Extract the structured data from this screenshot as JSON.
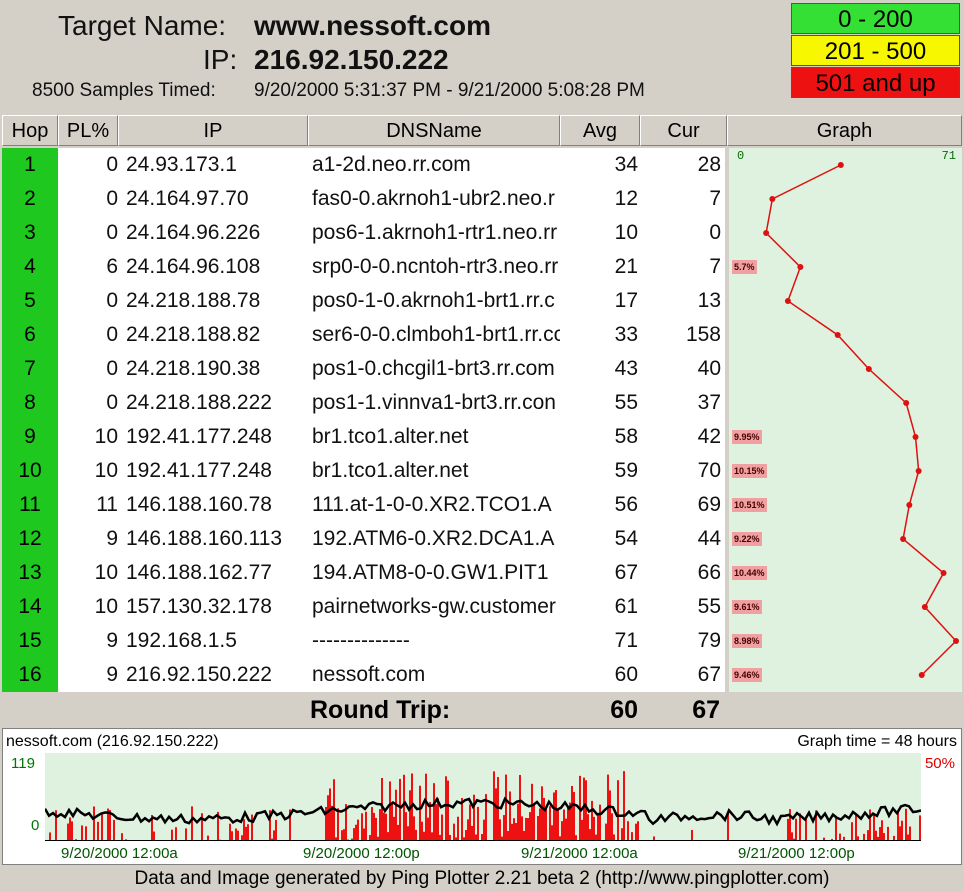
{
  "header": {
    "target_label": "Target Name:",
    "target_value": "www.nessoft.com",
    "ip_label": "IP:",
    "ip_value": "216.92.150.222",
    "samples_label": "8500 Samples Timed:",
    "samples_value": "9/20/2000 5:31:37 PM - 9/21/2000 5:08:28 PM"
  },
  "legend": [
    {
      "label": "0 - 200",
      "color": "#33e033"
    },
    {
      "label": "201 - 500",
      "color": "#f7f700"
    },
    {
      "label": "501 and up",
      "color": "#ee1111"
    }
  ],
  "columns": [
    "Hop",
    "PL%",
    "IP",
    "DNSName",
    "Avg",
    "Cur",
    "Graph"
  ],
  "graph_scale": {
    "min": "0",
    "max": "71",
    "max_value": 71
  },
  "hops": [
    {
      "hop": "1",
      "pl": "0",
      "ip": "24.93.173.1",
      "dns": "a1-2d.neo.rr.com",
      "avg": "34",
      "cur": "28",
      "pl_label": "",
      "avg_value": 34
    },
    {
      "hop": "2",
      "pl": "0",
      "ip": "24.164.97.70",
      "dns": "fas0-0.akrnoh1-ubr2.neo.r",
      "avg": "12",
      "cur": "7",
      "pl_label": "",
      "avg_value": 12
    },
    {
      "hop": "3",
      "pl": "0",
      "ip": "24.164.96.226",
      "dns": "pos6-1.akrnoh1-rtr1.neo.rr",
      "avg": "10",
      "cur": "0",
      "pl_label": "",
      "avg_value": 10
    },
    {
      "hop": "4",
      "pl": "6",
      "ip": "24.164.96.108",
      "dns": "srp0-0-0.ncntoh-rtr3.neo.rr",
      "avg": "21",
      "cur": "7",
      "pl_label": "5.7%",
      "avg_value": 21
    },
    {
      "hop": "5",
      "pl": "0",
      "ip": "24.218.188.78",
      "dns": "pos0-1-0.akrnoh1-brt1.rr.c",
      "avg": "17",
      "cur": "13",
      "pl_label": "",
      "avg_value": 17
    },
    {
      "hop": "6",
      "pl": "0",
      "ip": "24.218.188.82",
      "dns": "ser6-0-0.clmboh1-brt1.rr.cc",
      "avg": "33",
      "cur": "158",
      "pl_label": "",
      "avg_value": 33
    },
    {
      "hop": "7",
      "pl": "0",
      "ip": "24.218.190.38",
      "dns": "pos1-0.chcgil1-brt3.rr.com",
      "avg": "43",
      "cur": "40",
      "pl_label": "",
      "avg_value": 43
    },
    {
      "hop": "8",
      "pl": "0",
      "ip": "24.218.188.222",
      "dns": "pos1-1.vinnva1-brt3.rr.con",
      "avg": "55",
      "cur": "37",
      "pl_label": "",
      "avg_value": 55
    },
    {
      "hop": "9",
      "pl": "10",
      "ip": "192.41.177.248",
      "dns": "br1.tco1.alter.net",
      "avg": "58",
      "cur": "42",
      "pl_label": "9.95%",
      "avg_value": 58
    },
    {
      "hop": "10",
      "pl": "10",
      "ip": "192.41.177.248",
      "dns": "br1.tco1.alter.net",
      "avg": "59",
      "cur": "70",
      "pl_label": "10.15%",
      "avg_value": 59
    },
    {
      "hop": "11",
      "pl": "11",
      "ip": "146.188.160.78",
      "dns": "111.at-1-0-0.XR2.TCO1.A",
      "avg": "56",
      "cur": "69",
      "pl_label": "10.51%",
      "avg_value": 56
    },
    {
      "hop": "12",
      "pl": "9",
      "ip": "146.188.160.113",
      "dns": "192.ATM6-0.XR2.DCA1.A",
      "avg": "54",
      "cur": "44",
      "pl_label": "9.22%",
      "avg_value": 54
    },
    {
      "hop": "13",
      "pl": "10",
      "ip": "146.188.162.77",
      "dns": "194.ATM8-0-0.GW1.PIT1",
      "avg": "67",
      "cur": "66",
      "pl_label": "10.44%",
      "avg_value": 67
    },
    {
      "hop": "14",
      "pl": "10",
      "ip": "157.130.32.178",
      "dns": "pairnetworks-gw.customer",
      "avg": "61",
      "cur": "55",
      "pl_label": "9.61%",
      "avg_value": 61
    },
    {
      "hop": "15",
      "pl": "9",
      "ip": "192.168.1.5",
      "dns": "--------------",
      "avg": "71",
      "cur": "79",
      "pl_label": "8.98%",
      "avg_value": 71
    },
    {
      "hop": "16",
      "pl": "9",
      "ip": "216.92.150.222",
      "dns": "nessoft.com",
      "avg": "60",
      "cur": "67",
      "pl_label": "9.46%",
      "avg_value": 60
    }
  ],
  "round_trip": {
    "label": "Round Trip:",
    "avg": "60",
    "cur": "67"
  },
  "time_graph": {
    "title": "nessoft.com (216.92.150.222)",
    "graph_time": "Graph time = 48 hours",
    "y_max": "119",
    "y_min": "0",
    "loss_label": "50%",
    "x_labels": [
      "9/20/2000 12:00a",
      "9/20/2000 12:00p",
      "9/21/2000 12:00a",
      "9/21/2000 12:00p"
    ]
  },
  "footer": "Data and Image generated by Ping Plotter 2.21 beta 2 (http://www.pingplotter.com)"
}
